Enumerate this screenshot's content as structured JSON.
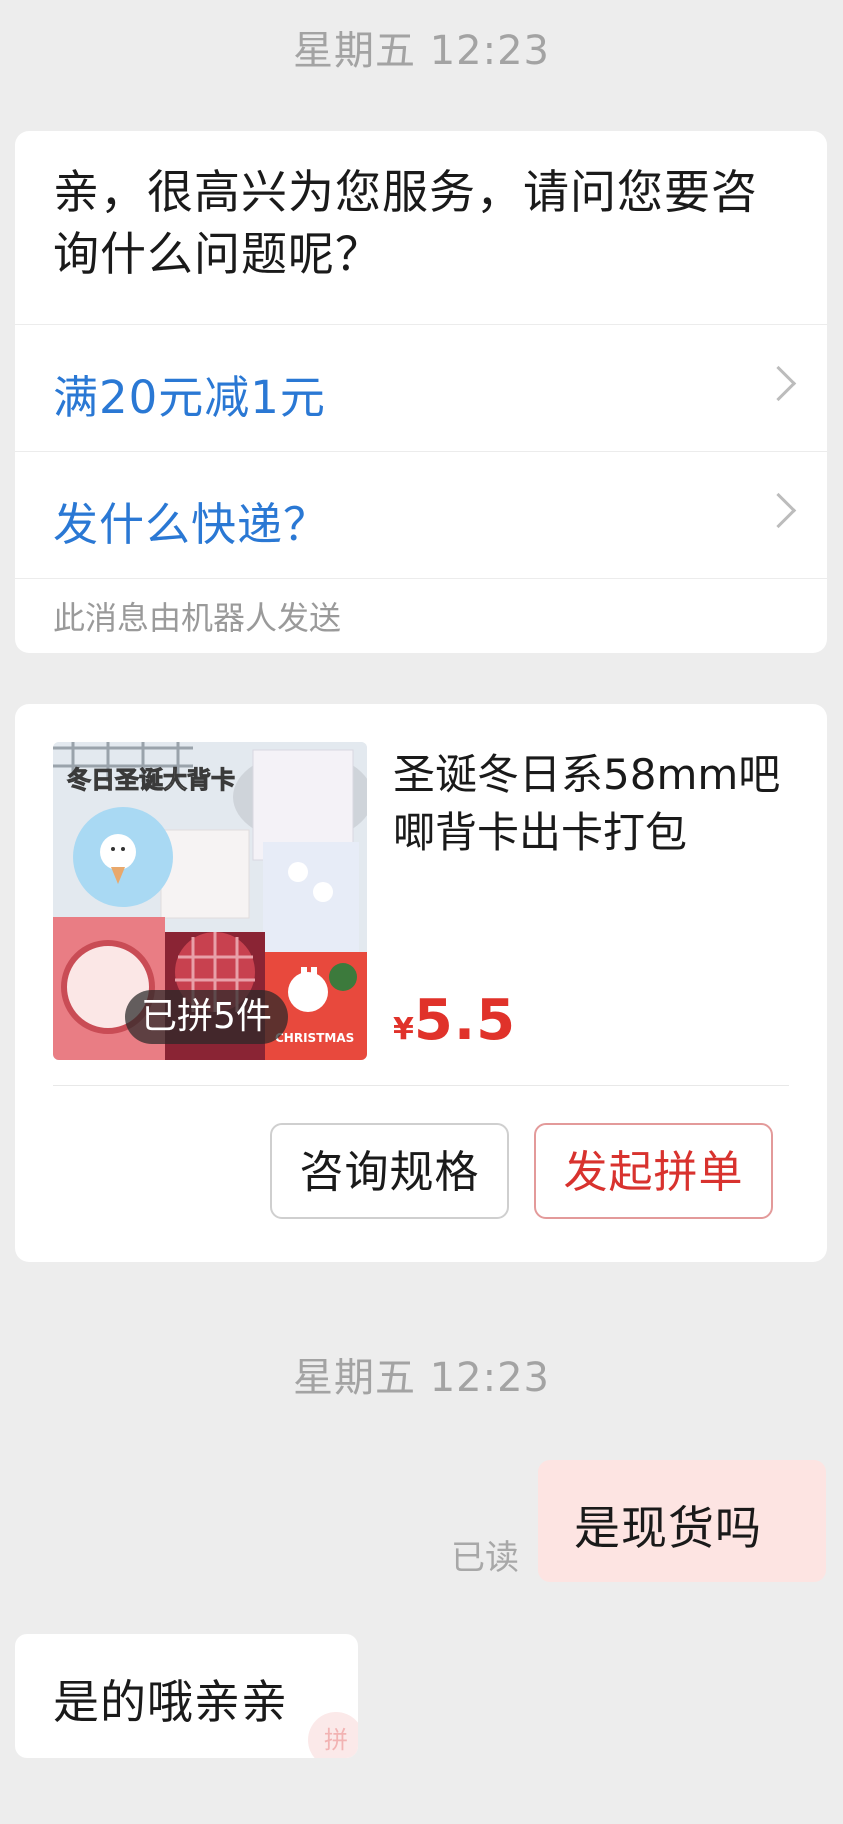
{
  "timestamps": [
    "星期五 12:23",
    "星期五 12:23"
  ],
  "bot_message": {
    "greeting": "亲，很高兴为您服务，请问您要咨询什么问题呢？",
    "options": [
      "满20元减1元",
      "发什么快递？"
    ],
    "footer": "此消息由机器人发送"
  },
  "product_card": {
    "image_caption": "冬日圣诞大背卡",
    "image_badge": "已拼5件",
    "image_christmas_text": "CHRISTMAS",
    "title": "圣诞冬日系58mm吧唧背卡出卡打包",
    "price_currency": "¥",
    "price_value": "5.5",
    "ask_button": "咨询规格",
    "group_button": "发起拼单",
    "colors": {
      "price": "#e0322a",
      "group_button": "#d8322e",
      "option_link": "#2a78d4"
    }
  },
  "messages": {
    "sent": "是现货吗",
    "read_status": "已读",
    "received": "是的哦亲亲",
    "seal_text": "拼"
  }
}
